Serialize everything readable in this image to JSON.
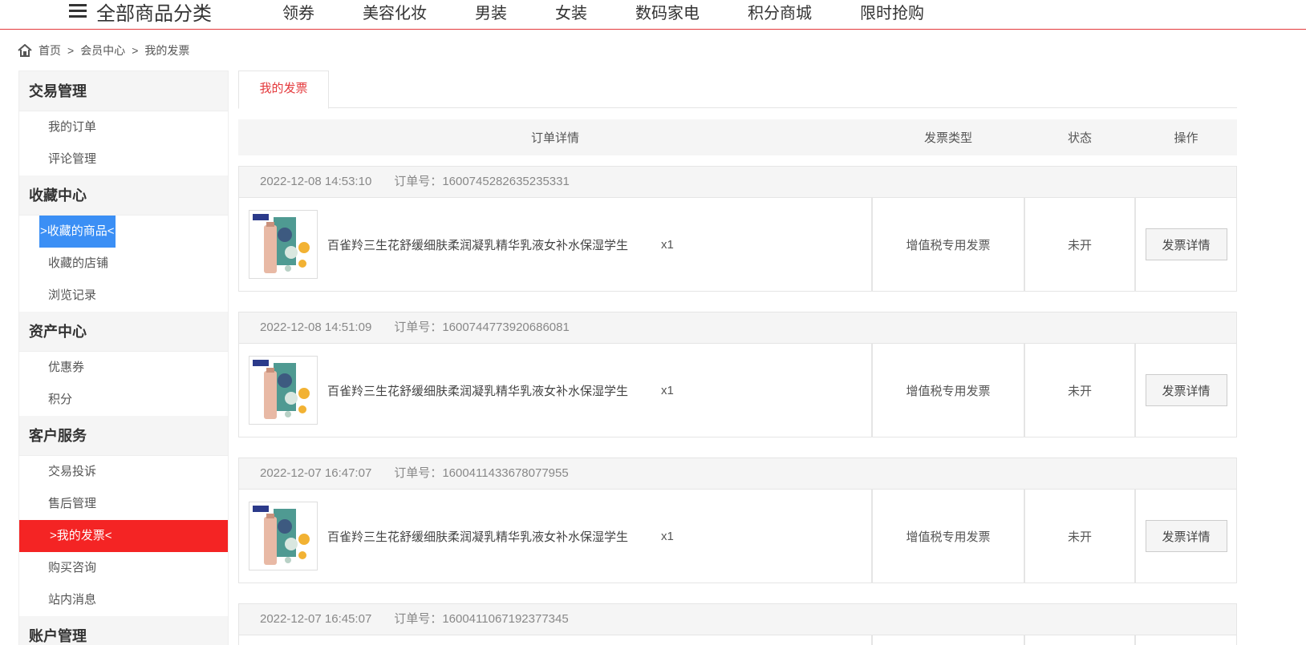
{
  "topnav": {
    "category_label": "全部商品分类",
    "links": [
      "领券",
      "美容化妆",
      "男装",
      "女装",
      "数码家电",
      "积分商城",
      "限时抢购"
    ]
  },
  "breadcrumb": {
    "home": "首页",
    "sep": ">",
    "member": "会员中心",
    "current": "我的发票"
  },
  "sidebar": {
    "groups": [
      {
        "title": "交易管理",
        "items": [
          "我的订单",
          "评论管理"
        ]
      },
      {
        "title": "收藏中心",
        "items": [
          ">收藏的商品<",
          "收藏的店铺",
          "浏览记录"
        ]
      },
      {
        "title": "资产中心",
        "items": [
          "优惠券",
          "积分"
        ]
      },
      {
        "title": "客户服务",
        "items": [
          "交易投诉",
          "售后管理",
          ">我的发票<",
          "购买咨询",
          "站内消息"
        ]
      },
      {
        "title": "账户管理",
        "items": []
      }
    ]
  },
  "main": {
    "tab": "我的发票",
    "columns": {
      "detail": "订单详情",
      "type": "发票类型",
      "status": "状态",
      "op": "操作"
    },
    "order_no_label": "订单号：",
    "orders": [
      {
        "time": "2022-12-08 14:53:10",
        "no": "1600745282635235331",
        "product": "百雀羚三生花舒缓细肤柔润凝乳精华乳液女补水保湿学生",
        "qty": "x1",
        "type": "增值税专用发票",
        "status": "未开",
        "button": "发票详情"
      },
      {
        "time": "2022-12-08 14:51:09",
        "no": "1600744773920686081",
        "product": "百雀羚三生花舒缓细肤柔润凝乳精华乳液女补水保湿学生",
        "qty": "x1",
        "type": "增值税专用发票",
        "status": "未开",
        "button": "发票详情"
      },
      {
        "time": "2022-12-07 16:47:07",
        "no": "1600411433678077955",
        "product": "百雀羚三生花舒缓细肤柔润凝乳精华乳液女补水保湿学生",
        "qty": "x1",
        "type": "增值税专用发票",
        "status": "未开",
        "button": "发票详情"
      },
      {
        "time": "2022-12-07 16:45:07",
        "no": "1600411067192377345"
      }
    ]
  },
  "colors": {
    "accent_red": "#e4393c",
    "active_red": "#f42424",
    "hover_blue": "#3b8ff5"
  }
}
